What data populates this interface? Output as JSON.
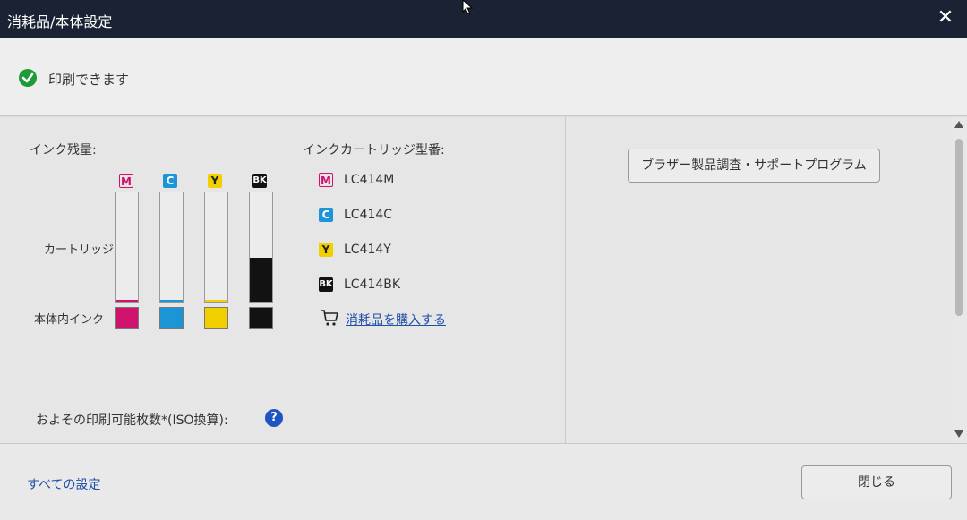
{
  "window": {
    "title": "消耗品/本体設定",
    "close_glyph": "✕"
  },
  "status": {
    "text": "印刷できます",
    "icon": "check-circle-icon",
    "color": "#1e9a36"
  },
  "ink": {
    "heading": "インク残量:",
    "cartridge_label": "カートリッジ",
    "internal_label": "本体内インク",
    "colors": [
      {
        "letter": "M",
        "hex": "#d0126f",
        "cartridge_level": 0.01
      },
      {
        "letter": "C",
        "hex": "#1b95d6",
        "cartridge_level": 0.01
      },
      {
        "letter": "Y",
        "hex": "#f2d000",
        "cartridge_level": 0.01
      },
      {
        "letter": "BK",
        "hex": "#121212",
        "cartridge_level": 0.4
      }
    ]
  },
  "cartridges": {
    "heading": "インクカートリッジ型番:",
    "items": [
      {
        "letter": "M",
        "model": "LC414M"
      },
      {
        "letter": "C",
        "model": "LC414C"
      },
      {
        "letter": "Y",
        "model": "LC414Y"
      },
      {
        "letter": "BK",
        "model": "LC414BK"
      }
    ],
    "buy_link": "消耗品を購入する"
  },
  "pages_estimate": {
    "label": "およその印刷可能枚数*(ISO換算):",
    "help_glyph": "?"
  },
  "right_panel": {
    "support_button": "ブラザー製品調査・サポートプログラム"
  },
  "footer": {
    "all_settings_link": "すべての設定",
    "close_button": "閉じる"
  }
}
